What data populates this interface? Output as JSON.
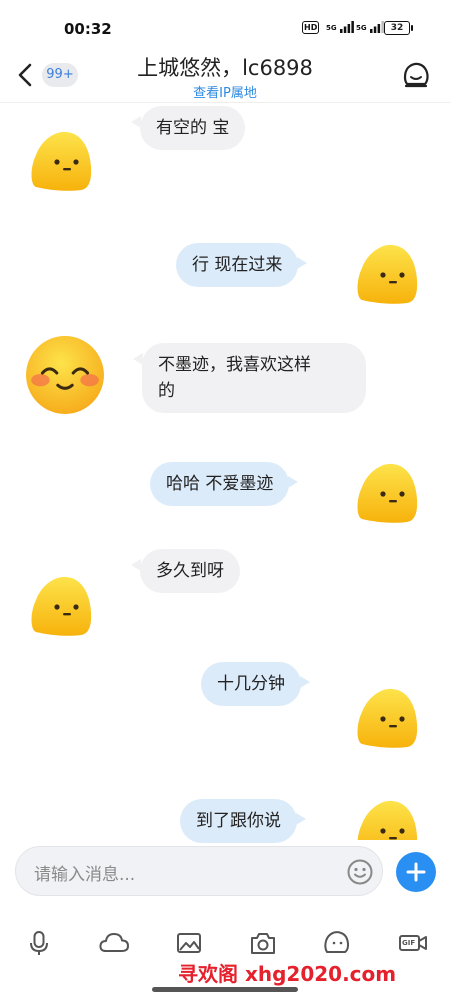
{
  "status_bar": {
    "time": "00:32",
    "hd": "HD",
    "signal1": "5G",
    "signal2": "5G",
    "battery": "32"
  },
  "header": {
    "unread_count": "99+",
    "title": "上城悠然，lc6898",
    "ip_link": "查看IP属地"
  },
  "messages": [
    {
      "side": "left",
      "text": "有空的 宝",
      "avatar": "yellow-blob-avatar"
    },
    {
      "side": "right",
      "text": "行 现在过来",
      "avatar": "yellow-blob-avatar"
    },
    {
      "side": "left",
      "text_line1": "不墨迹，我喜欢这样",
      "text_line2": "的",
      "avatar": "smiling-blush-emoji-avatar"
    },
    {
      "side": "right",
      "text": "哈哈  不爱墨迹",
      "avatar": "yellow-blob-avatar"
    },
    {
      "side": "left",
      "text": "多久到呀",
      "avatar": "yellow-blob-avatar"
    },
    {
      "side": "right",
      "text": "十几分钟",
      "avatar": "yellow-blob-avatar"
    },
    {
      "side": "right",
      "text": "到了跟你说",
      "avatar": "yellow-blob-avatar"
    }
  ],
  "input": {
    "placeholder": "请输入消息..."
  },
  "toolbar": {
    "items": [
      "microphone-icon",
      "cloud-icon",
      "image-icon",
      "camera-icon",
      "emoji-icon",
      "gif-icon"
    ],
    "gif_label": "GIF"
  },
  "watermark": "寻欢阁 xhg2020.com",
  "colors": {
    "accent": "#2a8ff2",
    "right_bubble": "#dcebfa",
    "left_bubble": "#f1f1f3",
    "watermark": "#e4212c",
    "avatar_yellow": "#fbc21a"
  }
}
